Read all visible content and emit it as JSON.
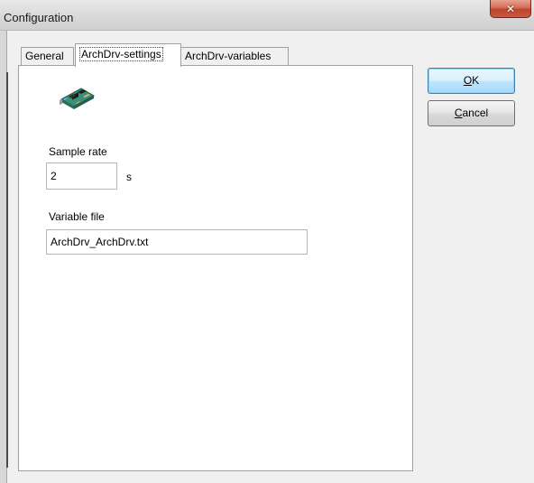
{
  "window": {
    "title": "Configuration"
  },
  "tabs": {
    "general": "General",
    "archdrv_settings": "ArchDrv-settings",
    "archdrv_variables": "ArchDrv-variables",
    "active": "ArchDrv-settings"
  },
  "settings": {
    "sample_rate_label": "Sample rate",
    "sample_rate_value": "2",
    "sample_rate_unit": "s",
    "variable_file_label": "Variable file",
    "variable_file_value": "ArchDrv_ArchDrv.txt"
  },
  "buttons": {
    "ok_mnemonic": "O",
    "ok_rest": "K",
    "cancel_mnemonic": "C",
    "cancel_rest": "ancel"
  },
  "icons": {
    "close": "close-icon",
    "device": "expansion-card-icon"
  },
  "colors": {
    "window_bg": "#f0f0f0",
    "panel_bg": "#ffffff",
    "close_red": "#c0432b",
    "default_button_border": "#3c7fb1"
  }
}
